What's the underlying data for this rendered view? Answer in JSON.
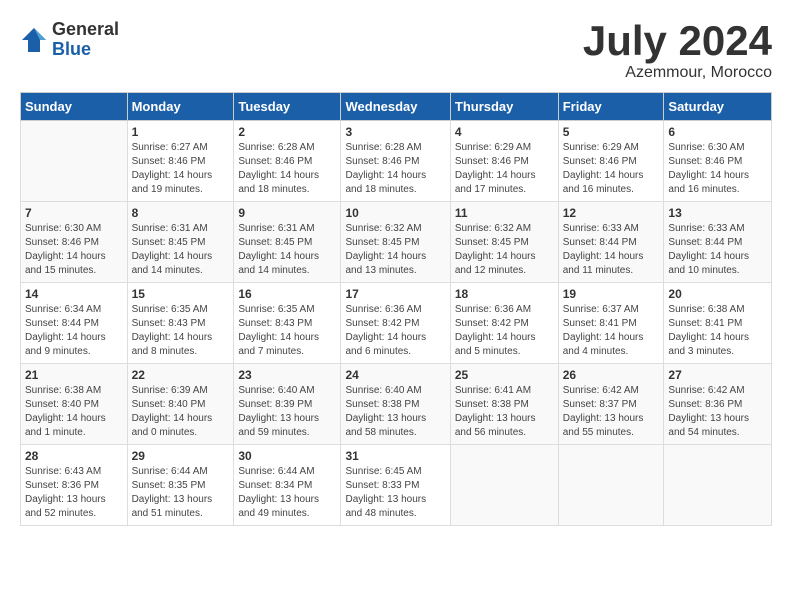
{
  "logo": {
    "general": "General",
    "blue": "Blue"
  },
  "title": "July 2024",
  "location": "Azemmour, Morocco",
  "days_of_week": [
    "Sunday",
    "Monday",
    "Tuesday",
    "Wednesday",
    "Thursday",
    "Friday",
    "Saturday"
  ],
  "weeks": [
    [
      {
        "day": "",
        "info": ""
      },
      {
        "day": "1",
        "info": "Sunrise: 6:27 AM\nSunset: 8:46 PM\nDaylight: 14 hours\nand 19 minutes."
      },
      {
        "day": "2",
        "info": "Sunrise: 6:28 AM\nSunset: 8:46 PM\nDaylight: 14 hours\nand 18 minutes."
      },
      {
        "day": "3",
        "info": "Sunrise: 6:28 AM\nSunset: 8:46 PM\nDaylight: 14 hours\nand 18 minutes."
      },
      {
        "day": "4",
        "info": "Sunrise: 6:29 AM\nSunset: 8:46 PM\nDaylight: 14 hours\nand 17 minutes."
      },
      {
        "day": "5",
        "info": "Sunrise: 6:29 AM\nSunset: 8:46 PM\nDaylight: 14 hours\nand 16 minutes."
      },
      {
        "day": "6",
        "info": "Sunrise: 6:30 AM\nSunset: 8:46 PM\nDaylight: 14 hours\nand 16 minutes."
      }
    ],
    [
      {
        "day": "7",
        "info": "Sunrise: 6:30 AM\nSunset: 8:46 PM\nDaylight: 14 hours\nand 15 minutes."
      },
      {
        "day": "8",
        "info": "Sunrise: 6:31 AM\nSunset: 8:45 PM\nDaylight: 14 hours\nand 14 minutes."
      },
      {
        "day": "9",
        "info": "Sunrise: 6:31 AM\nSunset: 8:45 PM\nDaylight: 14 hours\nand 14 minutes."
      },
      {
        "day": "10",
        "info": "Sunrise: 6:32 AM\nSunset: 8:45 PM\nDaylight: 14 hours\nand 13 minutes."
      },
      {
        "day": "11",
        "info": "Sunrise: 6:32 AM\nSunset: 8:45 PM\nDaylight: 14 hours\nand 12 minutes."
      },
      {
        "day": "12",
        "info": "Sunrise: 6:33 AM\nSunset: 8:44 PM\nDaylight: 14 hours\nand 11 minutes."
      },
      {
        "day": "13",
        "info": "Sunrise: 6:33 AM\nSunset: 8:44 PM\nDaylight: 14 hours\nand 10 minutes."
      }
    ],
    [
      {
        "day": "14",
        "info": "Sunrise: 6:34 AM\nSunset: 8:44 PM\nDaylight: 14 hours\nand 9 minutes."
      },
      {
        "day": "15",
        "info": "Sunrise: 6:35 AM\nSunset: 8:43 PM\nDaylight: 14 hours\nand 8 minutes."
      },
      {
        "day": "16",
        "info": "Sunrise: 6:35 AM\nSunset: 8:43 PM\nDaylight: 14 hours\nand 7 minutes."
      },
      {
        "day": "17",
        "info": "Sunrise: 6:36 AM\nSunset: 8:42 PM\nDaylight: 14 hours\nand 6 minutes."
      },
      {
        "day": "18",
        "info": "Sunrise: 6:36 AM\nSunset: 8:42 PM\nDaylight: 14 hours\nand 5 minutes."
      },
      {
        "day": "19",
        "info": "Sunrise: 6:37 AM\nSunset: 8:41 PM\nDaylight: 14 hours\nand 4 minutes."
      },
      {
        "day": "20",
        "info": "Sunrise: 6:38 AM\nSunset: 8:41 PM\nDaylight: 14 hours\nand 3 minutes."
      }
    ],
    [
      {
        "day": "21",
        "info": "Sunrise: 6:38 AM\nSunset: 8:40 PM\nDaylight: 14 hours\nand 1 minute."
      },
      {
        "day": "22",
        "info": "Sunrise: 6:39 AM\nSunset: 8:40 PM\nDaylight: 14 hours\nand 0 minutes."
      },
      {
        "day": "23",
        "info": "Sunrise: 6:40 AM\nSunset: 8:39 PM\nDaylight: 13 hours\nand 59 minutes."
      },
      {
        "day": "24",
        "info": "Sunrise: 6:40 AM\nSunset: 8:38 PM\nDaylight: 13 hours\nand 58 minutes."
      },
      {
        "day": "25",
        "info": "Sunrise: 6:41 AM\nSunset: 8:38 PM\nDaylight: 13 hours\nand 56 minutes."
      },
      {
        "day": "26",
        "info": "Sunrise: 6:42 AM\nSunset: 8:37 PM\nDaylight: 13 hours\nand 55 minutes."
      },
      {
        "day": "27",
        "info": "Sunrise: 6:42 AM\nSunset: 8:36 PM\nDaylight: 13 hours\nand 54 minutes."
      }
    ],
    [
      {
        "day": "28",
        "info": "Sunrise: 6:43 AM\nSunset: 8:36 PM\nDaylight: 13 hours\nand 52 minutes."
      },
      {
        "day": "29",
        "info": "Sunrise: 6:44 AM\nSunset: 8:35 PM\nDaylight: 13 hours\nand 51 minutes."
      },
      {
        "day": "30",
        "info": "Sunrise: 6:44 AM\nSunset: 8:34 PM\nDaylight: 13 hours\nand 49 minutes."
      },
      {
        "day": "31",
        "info": "Sunrise: 6:45 AM\nSunset: 8:33 PM\nDaylight: 13 hours\nand 48 minutes."
      },
      {
        "day": "",
        "info": ""
      },
      {
        "day": "",
        "info": ""
      },
      {
        "day": "",
        "info": ""
      }
    ]
  ]
}
